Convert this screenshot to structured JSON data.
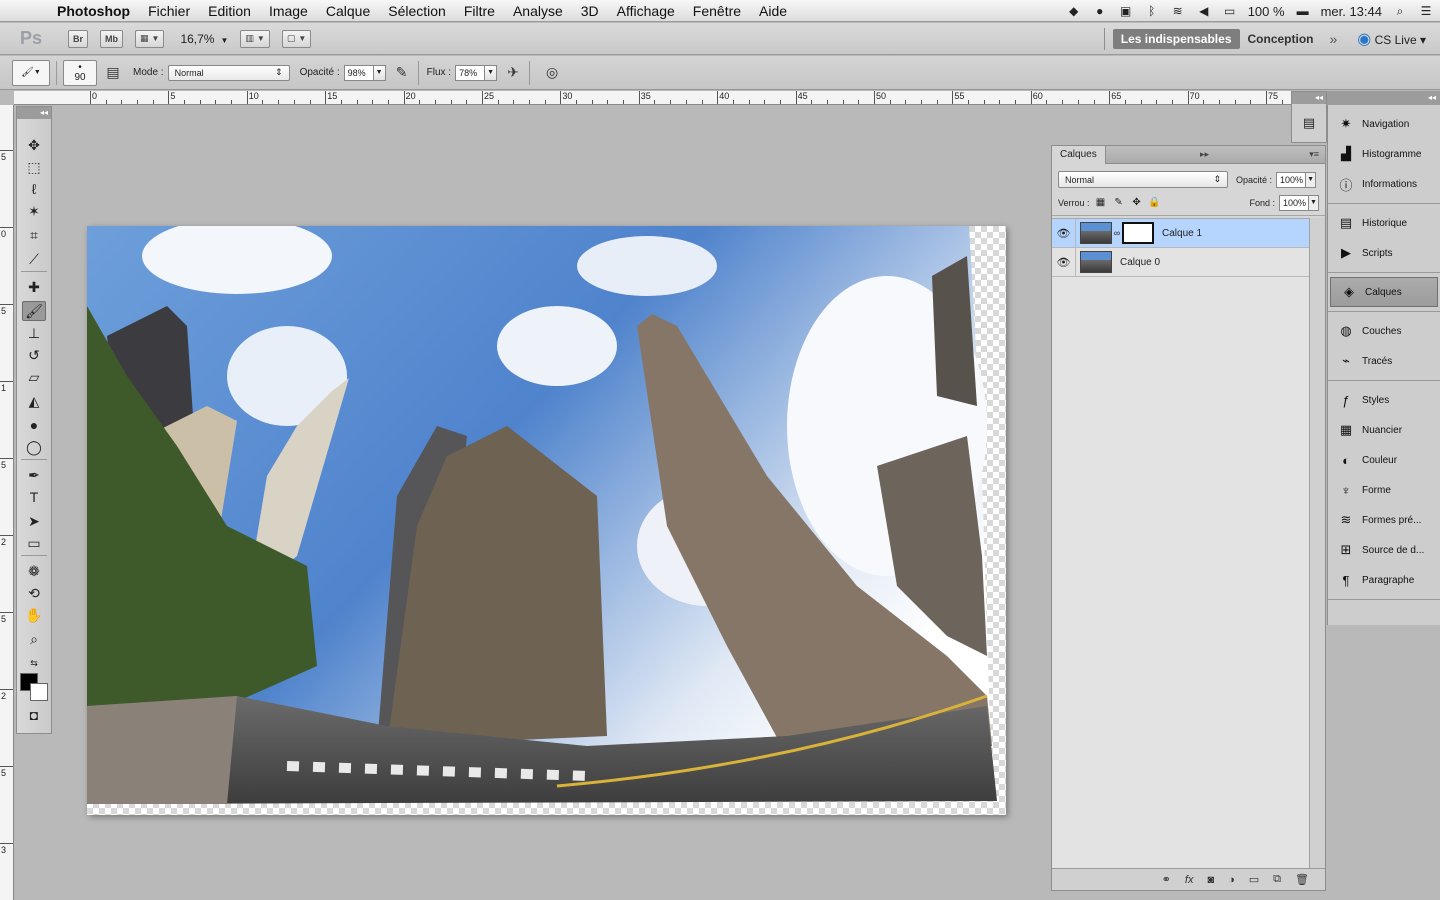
{
  "menubar": {
    "app": "Photoshop",
    "items": [
      "Fichier",
      "Edition",
      "Image",
      "Calque",
      "Sélection",
      "Filtre",
      "Analyse",
      "3D",
      "Affichage",
      "Fenêtre",
      "Aide"
    ],
    "battery": "100 %",
    "clock": "mer. 13:44"
  },
  "appbar": {
    "logo": "Ps",
    "bridge": "Br",
    "minibridge": "Mb",
    "zoom": "16,7%",
    "workspaces": [
      "Les indispensables",
      "Conception"
    ],
    "active_workspace": "Les indispensables",
    "cs_live": "CS Live"
  },
  "options": {
    "brush_size": "90",
    "mode_label": "Mode :",
    "mode_value": "Normal",
    "opacity_label": "Opacité :",
    "opacity_value": "98%",
    "flow_label": "Flux :",
    "flow_value": "78%"
  },
  "ruler": {
    "top_labels": [
      "0",
      "5",
      "10",
      "15",
      "20",
      "25",
      "30",
      "35",
      "40",
      "45",
      "50",
      "55",
      "60",
      "65",
      "70",
      "75"
    ],
    "left_labels": [
      "5",
      "0",
      "5",
      "1",
      "5",
      "2",
      "5",
      "2",
      "5",
      "3"
    ]
  },
  "layers_panel": {
    "tab": "Calques",
    "blend_mode": "Normal",
    "opacity_label": "Opacité :",
    "opacity_value": "100%",
    "lock_label": "Verrou :",
    "fill_label": "Fond :",
    "fill_value": "100%",
    "layers": [
      {
        "name": "Calque 1",
        "selected": true,
        "has_mask": true
      },
      {
        "name": "Calque 0",
        "selected": false,
        "has_mask": false
      }
    ]
  },
  "dock": {
    "groups": [
      [
        {
          "label": "Navigation",
          "icon": "navigator-icon"
        },
        {
          "label": "Histogramme",
          "icon": "histogram-icon"
        },
        {
          "label": "Informations",
          "icon": "info-icon"
        }
      ],
      [
        {
          "label": "Historique",
          "icon": "history-icon"
        },
        {
          "label": "Scripts",
          "icon": "actions-icon"
        }
      ],
      [
        {
          "label": "Calques",
          "icon": "layers-icon",
          "active": true
        }
      ],
      [
        {
          "label": "Couches",
          "icon": "channels-icon"
        },
        {
          "label": "Tracés",
          "icon": "paths-icon"
        }
      ],
      [
        {
          "label": "Styles",
          "icon": "styles-icon"
        },
        {
          "label": "Nuancier",
          "icon": "swatches-icon"
        },
        {
          "label": "Couleur",
          "icon": "color-icon"
        },
        {
          "label": "Forme",
          "icon": "brush-shape-icon"
        },
        {
          "label": "Formes pré...",
          "icon": "brush-presets-icon"
        },
        {
          "label": "Source de d...",
          "icon": "clone-source-icon"
        },
        {
          "label": "Paragraphe",
          "icon": "paragraph-icon"
        }
      ]
    ]
  },
  "colors": {
    "selection": "#b5d5ff",
    "sky": "#5d8fd3",
    "foreground": "#000000",
    "background": "#ffffff"
  }
}
